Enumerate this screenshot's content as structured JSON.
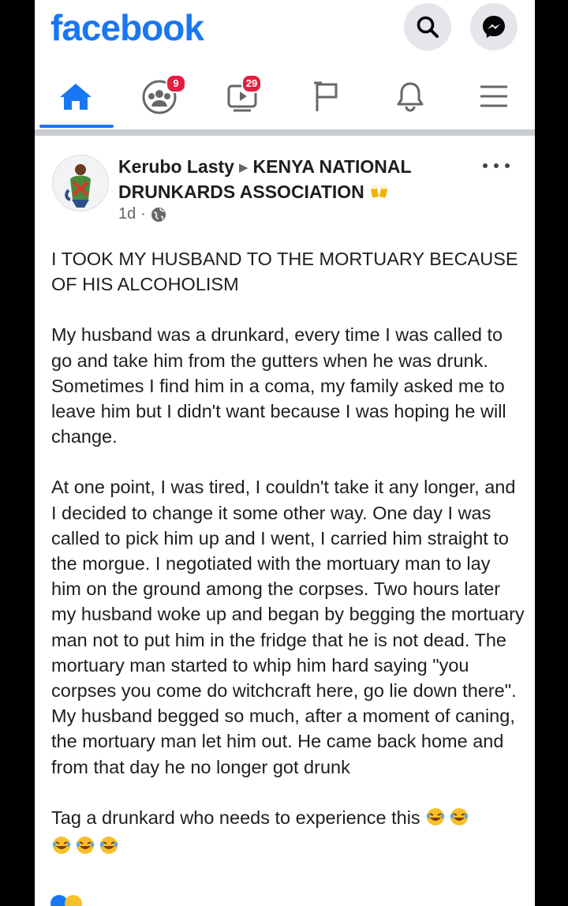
{
  "app": {
    "logo_text": "facebook"
  },
  "nav": {
    "groups_badge": "9",
    "watch_badge": "29"
  },
  "post": {
    "author": "Kerubo Lasty",
    "group": "KENYA NATIONAL DRUNKARDS ASSOCIATION",
    "time": "1d",
    "meta_separator": "·",
    "headline": "I TOOK MY HUSBAND TO THE MORTUARY BECAUSE OF HIS ALCOHOLISM",
    "paragraph_1": "My husband was a drunkard, every time I was called to go and take him from the gutters when he was drunk. Sometimes I find him in a coma, my family asked me to leave him but I didn't want because I was hoping he will change.",
    "paragraph_2": "At one point, I was tired, I couldn't take it any longer, and I decided to change it some other way. One day I was called to pick him up and I went, I carried him straight to the morgue. I negotiated with the mortuary man to lay him on the ground among the corpses. Two hours later my husband woke up and began by begging the mortuary man not to put him in the fridge that he is not dead. The mortuary man started to whip him hard saying \"you corpses you come do witchcraft here, go lie down there\". My husband begged so much, after a moment of caning, the mortuary man let him out. He came back home and from that day he no longer got drunk",
    "paragraph_3": "Tag a drunkard who needs to experience this"
  },
  "icons": {
    "search": "search-icon",
    "messenger": "messenger-icon",
    "home": "home-icon",
    "groups": "groups-icon",
    "watch": "watch-icon",
    "pages": "flag-icon",
    "notifications": "bell-icon",
    "menu": "menu-icon",
    "more": "more-options-icon",
    "privacy": "globe-icon",
    "laughing_emoji": "rofl-emoji-icon"
  },
  "colors": {
    "brand": "#1877f2",
    "badge": "#e41e3f",
    "text": "#1c1e21",
    "muted": "#65676b"
  }
}
